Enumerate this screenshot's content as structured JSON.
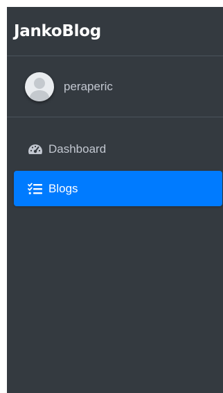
{
  "brand": {
    "title": "JankoBlog"
  },
  "user": {
    "name": "peraperic"
  },
  "nav": {
    "items": [
      {
        "label": "Dashboard",
        "icon": "tachometer-icon",
        "active": false
      },
      {
        "label": "Blogs",
        "icon": "tasks-list-icon",
        "active": true
      }
    ]
  },
  "colors": {
    "sidebar_bg": "#343a40",
    "active_bg": "#007bff",
    "text_muted": "#c2c7d0",
    "text_white": "#ffffff"
  }
}
